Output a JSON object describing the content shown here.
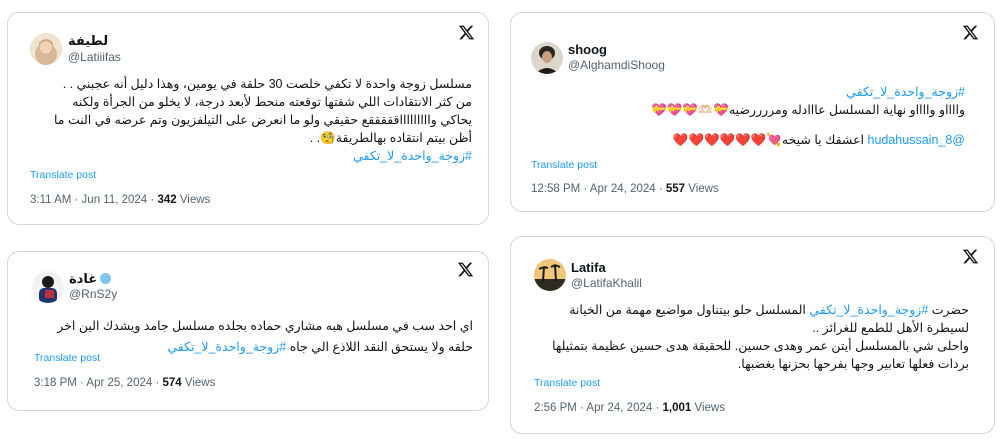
{
  "posts": [
    {
      "name": "لطيفة",
      "handle": "@Latiiifas",
      "lines": [
        "مسلسل زوجة واحدة لا تكفي خلصت 30 حلقة في يومين، وهذا دليل أنه عجبني . .",
        "من كثر الانتقادات اللي شفتها توقعته منحط لأبعد درجة، لا يخلو من الجرأة ولكنه",
        "يحاكي واااااااااقققققع حقيقي ولو ما انعرض على التيلفزيون وتم عرضه في النت ما",
        "أظن بيتم انتقاده بهالطريقة🧐. ."
      ],
      "hashtag": "#زوجة_واحدة_لا_تكفي",
      "translate": "Translate post",
      "time": "3:11 AM · Jun 11, 2024 · ",
      "views_count": "342",
      "views_label": " Views"
    },
    {
      "name": "shoog",
      "handle": "@AlghamdiShoog",
      "hashtag": "#زوجة_واحدة_لا_تكفي",
      "line1": "وااااو وااااو نهاية المسلسل عااادله ومررررضيه💝🫶🏻💝💝💝",
      "mention": "@hudahussain_8",
      "line2": " اعشقك يا شيخه💘",
      "hearts": "❤️❤️❤️❤️❤️❤️",
      "translate": "Translate post",
      "time": "12:58 PM · Apr 24, 2024 · ",
      "views_count": "557",
      "views_label": " Views"
    },
    {
      "name": "غادة",
      "handle": "@RnS2y",
      "lines": [
        "اي احد سب في مسلسل هبه مشاري حماده بجلده مسلسل جامد ويشدك الين اخر",
        "حلقه ولا يستحق النقد اللاذع الي جاه"
      ],
      "hashtag": "#زوجة_واحدة_لا_تكفي",
      "translate": "Translate post",
      "time": "3:18 PM · Apr 25, 2024 · ",
      "views_count": "574",
      "views_label": " Views"
    },
    {
      "name": "Latifa",
      "handle": "@LatifaKhalil",
      "prefix": "حضرت ",
      "hashtag": "#زوجة_واحدة_لا_تكفي",
      "line1_rest": " المسلسل حلو بيتناول مواضيع مهمة من الخيانة",
      "lines": [
        "لسيطرة الأهل للطمع للغرائز ..",
        "واحلى شي بالمسلسل أيتن عمر وهدى حسين. للحقيقة هدى حسين عظيمة بتمثيلها",
        "بردات فعلها تعابير وجها بفرحها بحزنها بغضبها."
      ],
      "translate": "Translate post",
      "time": "2:56 PM · Apr 24, 2024 · ",
      "views_count": "1,001",
      "views_label": " Views"
    }
  ],
  "colors": {
    "link": "#1d9bf0",
    "border": "#cfd9de",
    "muted": "#536471",
    "text": "#0f1419"
  }
}
